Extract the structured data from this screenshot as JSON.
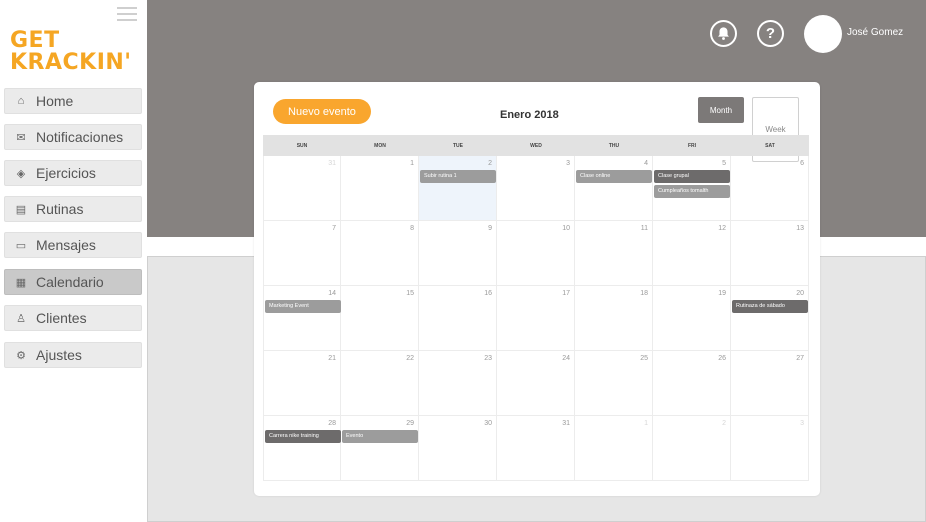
{
  "brand": {
    "line1": "GET",
    "line2": "KRACKIN'",
    "color": "#f5a623"
  },
  "sidebar": {
    "items": [
      {
        "label": "Home",
        "icon": "home-icon",
        "glyph": "⌂"
      },
      {
        "label": "Notificaciones",
        "icon": "mail-icon",
        "glyph": "✉"
      },
      {
        "label": "Ejercicios",
        "icon": "exercise-icon",
        "glyph": "◈"
      },
      {
        "label": "Rutinas",
        "icon": "document-icon",
        "glyph": "▤"
      },
      {
        "label": "Mensajes",
        "icon": "message-icon",
        "glyph": "▭"
      },
      {
        "label": "Calendario",
        "icon": "calendar-icon",
        "glyph": "▦",
        "active": true
      },
      {
        "label": "Clientes",
        "icon": "user-icon",
        "glyph": "♙"
      },
      {
        "label": "Ajustes",
        "icon": "settings-icon",
        "glyph": "⚙"
      }
    ]
  },
  "header": {
    "bell_icon": "bell-icon",
    "help_icon": "help-icon",
    "help_glyph": "?",
    "user_name": "José Gomez"
  },
  "calendar": {
    "new_event_label": "Nuevo evento",
    "title": "Enero 2018",
    "month_label": "Month",
    "week_label": "Week",
    "days_of_week": [
      "SUN",
      "MON",
      "TUE",
      "WED",
      "THU",
      "FRI",
      "SAT"
    ],
    "weeks": [
      [
        {
          "day": "31",
          "muted": true
        },
        {
          "day": "1"
        },
        {
          "day": "2",
          "today": true,
          "events": [
            {
              "label": "Subir rutina 1",
              "style": "light"
            }
          ]
        },
        {
          "day": "3"
        },
        {
          "day": "4",
          "events": [
            {
              "label": "Clase online",
              "style": "light"
            }
          ]
        },
        {
          "day": "5",
          "events": [
            {
              "label": "Clase grupal",
              "style": "dark"
            },
            {
              "label": "Cumpleaños tomalth",
              "style": "light"
            }
          ]
        },
        {
          "day": "6"
        }
      ],
      [
        {
          "day": "7"
        },
        {
          "day": "8"
        },
        {
          "day": "9"
        },
        {
          "day": "10"
        },
        {
          "day": "11"
        },
        {
          "day": "12"
        },
        {
          "day": "13"
        }
      ],
      [
        {
          "day": "14",
          "events": [
            {
              "label": "Marketing Event",
              "style": "light"
            }
          ]
        },
        {
          "day": "15"
        },
        {
          "day": "16"
        },
        {
          "day": "17"
        },
        {
          "day": "18"
        },
        {
          "day": "19"
        },
        {
          "day": "20",
          "events": [
            {
              "label": "Rutinaza de sábado",
              "style": "dark"
            }
          ]
        }
      ],
      [
        {
          "day": "21"
        },
        {
          "day": "22"
        },
        {
          "day": "23"
        },
        {
          "day": "24"
        },
        {
          "day": "25"
        },
        {
          "day": "26"
        },
        {
          "day": "27"
        }
      ],
      [
        {
          "day": "28",
          "events": [
            {
              "label": "Carrera nike training",
              "style": "dark"
            }
          ]
        },
        {
          "day": "29",
          "events": [
            {
              "label": "Evento",
              "style": "light"
            }
          ]
        },
        {
          "day": "30"
        },
        {
          "day": "31"
        },
        {
          "day": "1",
          "muted": true
        },
        {
          "day": "2",
          "muted": true
        },
        {
          "day": "3",
          "muted": true
        }
      ]
    ]
  },
  "colors": {
    "header_bg": "#868280",
    "accent_orange": "#f9a62e",
    "event_dark": "#6d6b6b",
    "event_light": "#9c9c9c"
  }
}
